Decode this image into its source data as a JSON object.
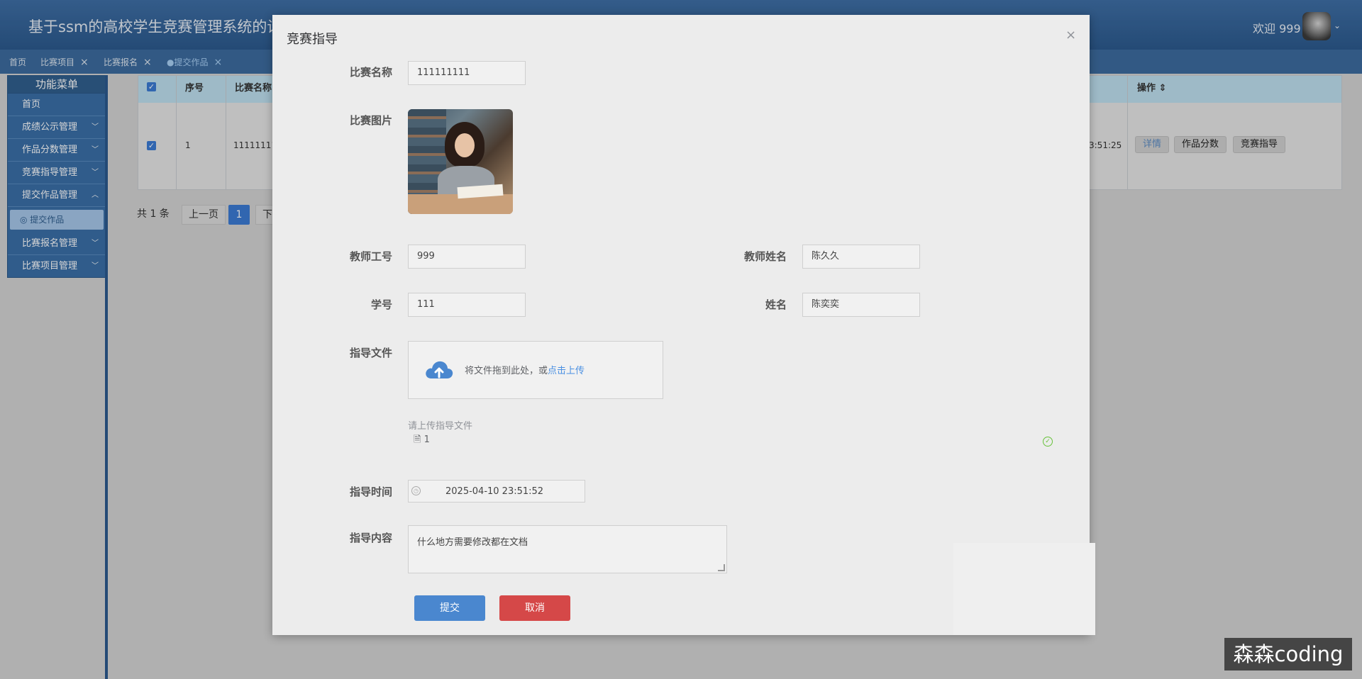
{
  "header": {
    "title": "基于ssm的高校学生竞赛管理系统的设",
    "welcome": "欢迎 999"
  },
  "tabs": [
    {
      "label": "首页",
      "closable": false
    },
    {
      "label": "比赛项目",
      "closable": true
    },
    {
      "label": "比赛报名",
      "closable": true
    },
    {
      "label": "●提交作品",
      "closable": true
    }
  ],
  "sidebar": {
    "header": "功能菜单",
    "items": [
      {
        "label": "首页"
      },
      {
        "label": "成绩公示管理"
      },
      {
        "label": "作品分数管理"
      },
      {
        "label": "竞赛指导管理"
      },
      {
        "label": "提交作品管理"
      },
      {
        "label": "比赛报名管理"
      },
      {
        "label": "比赛项目管理"
      }
    ],
    "sub_item": "提交作品"
  },
  "table": {
    "headers": {
      "index": "序号",
      "name": "比赛名称",
      "ops": "操作"
    },
    "row": {
      "index": "1",
      "name": "11111111",
      "time_fragment": "3:51:25",
      "ops": {
        "detail": "详情",
        "score": "作品分数",
        "guide": "竞赛指导"
      }
    }
  },
  "pagination": {
    "total": "共 1 条",
    "prev": "上一页",
    "current": "1",
    "next": "下"
  },
  "modal": {
    "title": "竞赛指导",
    "close": "×",
    "fields": {
      "contest_name": {
        "label": "比赛名称",
        "value": "111111111"
      },
      "contest_image": {
        "label": "比赛图片"
      },
      "teacher_id": {
        "label": "教师工号",
        "value": "999"
      },
      "teacher_name": {
        "label": "教师姓名",
        "value": "陈久久"
      },
      "student_id": {
        "label": "学号",
        "value": "111"
      },
      "student_name": {
        "label": "姓名",
        "value": "陈奕奕"
      },
      "guide_file": {
        "label": "指导文件",
        "drop_text": "将文件拖到此处，或",
        "upload_link": "点击上传",
        "hint": "请上传指导文件",
        "file_name": "1"
      },
      "guide_time": {
        "label": "指导时间",
        "value": "2025-04-10 23:51:52"
      },
      "guide_content": {
        "label": "指导内容",
        "value": "什么地方需要修改都在文档"
      }
    },
    "buttons": {
      "submit": "提交",
      "cancel": "取消"
    }
  },
  "watermark": "森森coding",
  "colors": {
    "primary": "#4a87cf",
    "danger": "#d54848",
    "header": "#2c5a8e",
    "success": "#67c23a"
  }
}
